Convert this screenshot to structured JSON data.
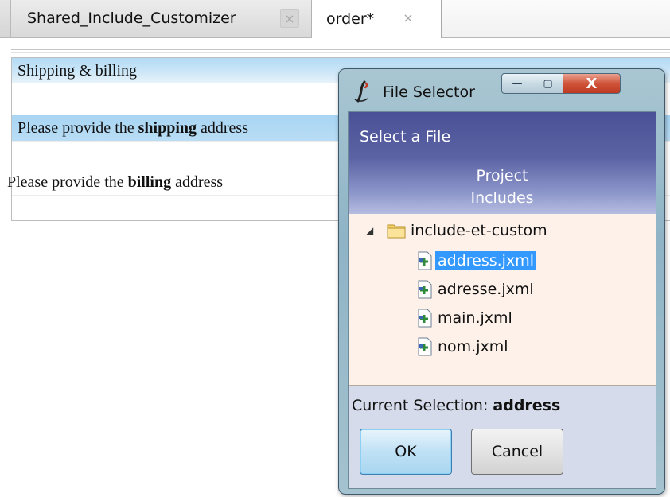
{
  "tabs": [
    {
      "label": "Shared_Include_Customizer",
      "close": "×",
      "active": false
    },
    {
      "label": "order*",
      "close": "×",
      "active": true
    }
  ],
  "form": {
    "section_title": "Shipping & billing",
    "shipping": {
      "prefix": "Please provide the ",
      "bold": "shipping",
      "suffix": " address"
    },
    "billing": {
      "prefix": "Please provide the ",
      "bold": "billing",
      "suffix": " address"
    }
  },
  "dialog": {
    "title": "File Selector",
    "window_buttons": {
      "minimize": "—",
      "maximize": "▢",
      "close": "X"
    },
    "select_label": "Select a File",
    "project_line1": "Project",
    "project_line2": "Includes",
    "tree": {
      "root": "include-et-custom",
      "expand_arrow": "◢",
      "files": [
        "address.jxml",
        "adresse.jxml",
        "main.jxml",
        "nom.jxml"
      ],
      "selected_index": 0
    },
    "current_selection_label": "Current Selection: ",
    "current_selection_value": "address",
    "ok_label": "OK",
    "cancel_label": "Cancel"
  },
  "colors": {
    "selection_blue": "#3399ff",
    "header_band": "#4a5196",
    "tree_background": "#fdf1ea",
    "form_highlight": "#a8d5f3"
  },
  "icons": {
    "app": "java-cup-icon",
    "folder": "folder-icon",
    "file": "jxml-file-icon"
  }
}
